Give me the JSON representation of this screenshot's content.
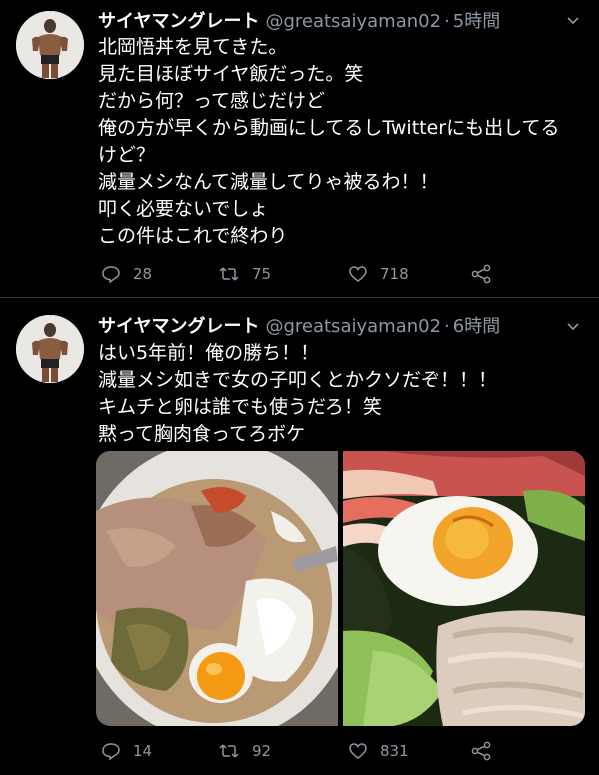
{
  "tweets": [
    {
      "name": "サイヤマングレート",
      "handle": "@greatsaiyaman02",
      "separator": "·",
      "time": "5時間",
      "lines": [
        "北岡悟丼を見てきた。",
        "見た目ほぼサイヤ飯だった。笑",
        "だから何？って感じだけど",
        "俺の方が早くから動画にしてるしTwitterにも出してる",
        "けど？",
        "減量メシなんて減量してりゃ被るわ！！",
        "叩く必要ないでしょ",
        "この件はこれで終わり"
      ],
      "replies": "28",
      "retweets": "75",
      "likes": "718"
    },
    {
      "name": "サイヤマングレート",
      "handle": "@greatsaiyaman02",
      "separator": "·",
      "time": "6時間",
      "lines": [
        "はい5年前！俺の勝ち！！",
        "減量メシ如きで女の子叩くとかクソだぞ！！！",
        "キムチと卵は誰でも使うだろ！笑",
        "黙って胸肉食ってろボケ"
      ],
      "replies": "14",
      "retweets": "92",
      "likes": "831",
      "photos": [
        "tuna-natto-egg-rice-bowl-photo",
        "chicken-egg-salad-bowl-photo"
      ]
    }
  ],
  "icons": {
    "reply": "reply-icon",
    "retweet": "retweet-icon",
    "like": "heart-icon",
    "share": "share-icon",
    "more": "chevron-down-icon",
    "avatar": "avatar-muscular-man"
  },
  "colors": {
    "background": "#000000",
    "text": "#ffffff",
    "secondary": "#8b98a5",
    "divider": "#2f3336"
  }
}
